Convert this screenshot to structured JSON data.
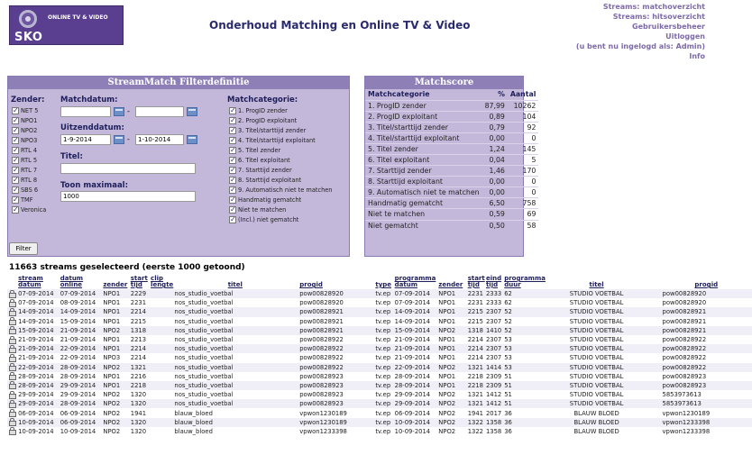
{
  "header": {
    "logo_sub": "ONLINE TV & VIDEO",
    "logo_text": "SKO",
    "title": "Onderhoud Matching en Online TV & Video",
    "nav": [
      {
        "label": "Streams: matchoverzicht"
      },
      {
        "label": "Streams: hitsoverzicht"
      },
      {
        "label": "Gebruikersbeheer"
      },
      {
        "label": "Uitloggen"
      }
    ],
    "login_status": "(u bent nu ingelogd als: Admin)",
    "info": "Info"
  },
  "filter": {
    "title": "StreamMatch Filterdefinitie",
    "zender_label": "Zender:",
    "zenders": [
      "NET 5",
      "NPO1",
      "NPO2",
      "NPO3",
      "RTL 4",
      "RTL 5",
      "RTL 7",
      "RTL 8",
      "SBS 6",
      "TMF",
      "Veronica"
    ],
    "matchdatum_label": "Matchdatum:",
    "matchdatum_from": "",
    "matchdatum_to": "",
    "uitzenddatum_label": "Uitzenddatum:",
    "uitzenddatum_from": "1-9-2014",
    "uitzenddatum_to": "1-10-2014",
    "titel_label": "Titel:",
    "titel_value": "",
    "toon_label": "Toon maximaal:",
    "toon_value": "1000",
    "dash": "-",
    "matchcat_label": "Matchcategorie:",
    "categories": [
      "1. ProgID zender",
      "2. ProgID exploitant",
      "3. Titel/starttijd zender",
      "4. Titel/starttijd exploitant",
      "5. Titel zender",
      "6. Titel exploitant",
      "7. Starttijd zender",
      "8. Starttijd exploitant",
      "9. Automatisch niet te matchen",
      "Handmatig gematcht",
      "Niet te matchen",
      "(Incl.) niet gematcht"
    ],
    "button": "Filter"
  },
  "score": {
    "title": "Matchscore",
    "headers": {
      "cat": "Matchcategorie",
      "pct": "%",
      "count": "Aantal"
    },
    "rows": [
      {
        "cat": "1. ProgID zender",
        "pct": "87,99",
        "count": "10262"
      },
      {
        "cat": "2. ProgID exploitant",
        "pct": "0,89",
        "count": "104"
      },
      {
        "cat": "3. Titel/starttijd zender",
        "pct": "0,79",
        "count": "92"
      },
      {
        "cat": "4. Titel/starttijd exploitant",
        "pct": "0,00",
        "count": "0"
      },
      {
        "cat": "5. Titel zender",
        "pct": "1,24",
        "count": "145"
      },
      {
        "cat": "6. Titel exploitant",
        "pct": "0,04",
        "count": "5"
      },
      {
        "cat": "7. Starttijd zender",
        "pct": "1,46",
        "count": "170"
      },
      {
        "cat": "8. Starttijd exploitant",
        "pct": "0,00",
        "count": "0"
      },
      {
        "cat": "9. Automatisch niet te matchen",
        "pct": "0,00",
        "count": "0"
      },
      {
        "cat": "Handmatig gematcht",
        "pct": "6,50",
        "count": "758"
      },
      {
        "cat": "Niet te matchen",
        "pct": "0,59",
        "count": "69"
      },
      {
        "cat": "Niet gematcht",
        "pct": "0,50",
        "count": "58"
      }
    ]
  },
  "summary": "11663 streams geselecteerd (eerste 1000 getoond)",
  "table": {
    "headers": [
      "stream datum",
      "datum online",
      "zender",
      "start tijd",
      "clip lengte",
      "titel",
      "progid",
      "type",
      "programma datum",
      "zender",
      "start tijd",
      "eind tijd",
      "programma duur",
      "titel",
      "progid"
    ],
    "rows": [
      [
        "07-09-2014",
        "07-09-2014",
        "NPO1",
        "2229",
        "",
        "nos_studio_voetbal",
        "pow00828920",
        "tv.ep",
        "07-09-2014",
        "NPO1",
        "2231",
        "2333",
        "62",
        "STUDIO VOETBAL",
        "pow00828920"
      ],
      [
        "07-09-2014",
        "08-09-2014",
        "NPO1",
        "2231",
        "",
        "nos_studio_voetbal",
        "pow00828920",
        "tv.ep",
        "07-09-2014",
        "NPO1",
        "2231",
        "2333",
        "62",
        "STUDIO VOETBAL",
        "pow00828920"
      ],
      [
        "14-09-2014",
        "14-09-2014",
        "NPO1",
        "2214",
        "",
        "nos_studio_voetbal",
        "pow00828921",
        "tv.ep",
        "14-09-2014",
        "NPO1",
        "2215",
        "2307",
        "52",
        "STUDIO VOETBAL",
        "pow00828921"
      ],
      [
        "14-09-2014",
        "15-09-2014",
        "NPO1",
        "2215",
        "",
        "nos_studio_voetbal",
        "pow00828921",
        "tv.ep",
        "14-09-2014",
        "NPO1",
        "2215",
        "2307",
        "52",
        "STUDIO VOETBAL",
        "pow00828921"
      ],
      [
        "15-09-2014",
        "21-09-2014",
        "NPO2",
        "1318",
        "",
        "nos_studio_voetbal",
        "pow00828921",
        "tv.ep",
        "15-09-2014",
        "NPO2",
        "1318",
        "1410",
        "52",
        "STUDIO VOETBAL",
        "pow00828921"
      ],
      [
        "21-09-2014",
        "21-09-2014",
        "NPO1",
        "2213",
        "",
        "nos_studio_voetbal",
        "pow00828922",
        "tv.ep",
        "21-09-2014",
        "NPO1",
        "2214",
        "2307",
        "53",
        "STUDIO VOETBAL",
        "pow00828922"
      ],
      [
        "21-09-2014",
        "22-09-2014",
        "NPO1",
        "2214",
        "",
        "nos_studio_voetbal",
        "pow00828922",
        "tv.ep",
        "21-09-2014",
        "NPO1",
        "2214",
        "2307",
        "53",
        "STUDIO VOETBAL",
        "pow00828922"
      ],
      [
        "21-09-2014",
        "22-09-2014",
        "NPO3",
        "2214",
        "",
        "nos_studio_voetbal",
        "pow00828922",
        "tv.ep",
        "21-09-2014",
        "NPO1",
        "2214",
        "2307",
        "53",
        "STUDIO VOETBAL",
        "pow00828922"
      ],
      [
        "22-09-2014",
        "28-09-2014",
        "NPO2",
        "1321",
        "",
        "nos_studio_voetbal",
        "pow00828922",
        "tv.ep",
        "22-09-2014",
        "NPO2",
        "1321",
        "1414",
        "53",
        "STUDIO VOETBAL",
        "pow00828922"
      ],
      [
        "28-09-2014",
        "28-09-2014",
        "NPO1",
        "2216",
        "",
        "nos_studio_voetbal",
        "pow00828923",
        "tv.ep",
        "28-09-2014",
        "NPO1",
        "2218",
        "2309",
        "51",
        "STUDIO VOETBAL",
        "pow00828923"
      ],
      [
        "28-09-2014",
        "29-09-2014",
        "NPO1",
        "2218",
        "",
        "nos_studio_voetbal",
        "pow00828923",
        "tv.ep",
        "28-09-2014",
        "NPO1",
        "2218",
        "2309",
        "51",
        "STUDIO VOETBAL",
        "pow00828923"
      ],
      [
        "29-09-2014",
        "29-09-2014",
        "NPO2",
        "1320",
        "",
        "nos_studio_voetbal",
        "pow00828923",
        "tv.ep",
        "29-09-2014",
        "NPO2",
        "1321",
        "1412",
        "51",
        "STUDIO VOETBAL",
        "5853973613"
      ],
      [
        "29-09-2014",
        "28-09-2014",
        "NPO2",
        "1320",
        "",
        "nos_studio_voetbal",
        "pow00828923",
        "tv.ep",
        "29-09-2014",
        "NPO2",
        "1321",
        "1412",
        "51",
        "STUDIO VOETBAL",
        "5853973613"
      ],
      [
        "06-09-2014",
        "06-09-2014",
        "NPO2",
        "1941",
        "",
        "blauw_bloed",
        "vpwon1230189",
        "tv.ep",
        "06-09-2014",
        "NPO2",
        "1941",
        "2017",
        "36",
        "BLAUW BLOED",
        "vpwon1230189"
      ],
      [
        "10-09-2014",
        "06-09-2014",
        "NPO2",
        "1320",
        "",
        "blauw_bloed",
        "vpwon1230189",
        "tv.ep",
        "10-09-2014",
        "NPO2",
        "1322",
        "1358",
        "36",
        "BLAUW BLOED",
        "vpwon1233398"
      ],
      [
        "10-09-2014",
        "10-09-2014",
        "NPO2",
        "1320",
        "",
        "blauw_bloed",
        "vpwon1233398",
        "tv.ep",
        "10-09-2014",
        "NPO2",
        "1322",
        "1358",
        "36",
        "BLAUW BLOED",
        "vpwon1233398"
      ]
    ]
  }
}
